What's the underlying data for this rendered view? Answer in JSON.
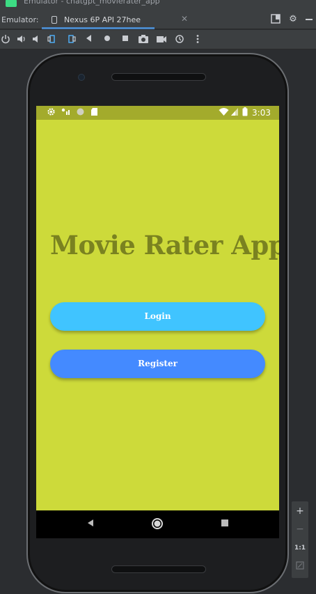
{
  "window": {
    "title": "Emulator - chatgpt_movierater_app"
  },
  "tabs": {
    "emulator_label": "Emulator:",
    "active_tab": "Nexus 6P API 27hee",
    "close_glyph": "✕"
  },
  "toolbar_icons": [
    "power-icon",
    "volume-up-icon",
    "volume-down-icon",
    "rotate-left-icon",
    "rotate-right-icon",
    "back-icon",
    "home-icon",
    "overview-icon",
    "camera-icon",
    "video-icon",
    "snapshot-icon",
    "more-icon"
  ],
  "status_bar": {
    "time": "3:03",
    "left_icons": [
      "settings-icon",
      "data-icon",
      "circle-icon",
      "sd-card-icon"
    ],
    "right_icons": [
      "wifi-icon",
      "signal-icon",
      "battery-icon"
    ]
  },
  "app": {
    "title": "Movie Rater App",
    "login_label": "Login",
    "register_label": "Register",
    "colors": {
      "background": "#cdda3a",
      "status_bar": "#a3ab2c",
      "title": "#7a8220",
      "login_button": "#40c4ff",
      "register_button": "#448aff"
    }
  },
  "nav_bar": {
    "back": "◀",
    "home": "●",
    "overview": "■"
  },
  "side_panel": {
    "zoom_in": "+",
    "zoom_out": "−",
    "one_to_one": "1:1"
  }
}
